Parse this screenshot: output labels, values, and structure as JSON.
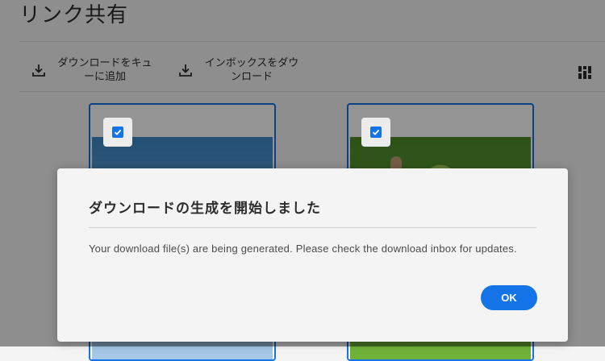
{
  "page": {
    "title": "リンク共有",
    "toolbar": {
      "queue_download_label": "ダウンロードをキューに追加",
      "download_inbox_label": "インボックスをダウンロード",
      "download_icon": "download-icon",
      "grid_view_icon": "grid-view-icon"
    },
    "cards": [
      {
        "selected": true,
        "checkbox_icon": "checkbox-checked-icon"
      },
      {
        "selected": true,
        "checkbox_icon": "checkbox-checked-icon"
      }
    ]
  },
  "dialog": {
    "title": "ダウンロードの生成を開始しました",
    "message": "Your download file(s) are being generated. Please check the download inbox for updates.",
    "ok_label": "OK"
  },
  "colors": {
    "accent": "#1473e6",
    "overlay": "rgba(0,0,0,0.42)",
    "dialog_background": "#f4f4f4"
  }
}
